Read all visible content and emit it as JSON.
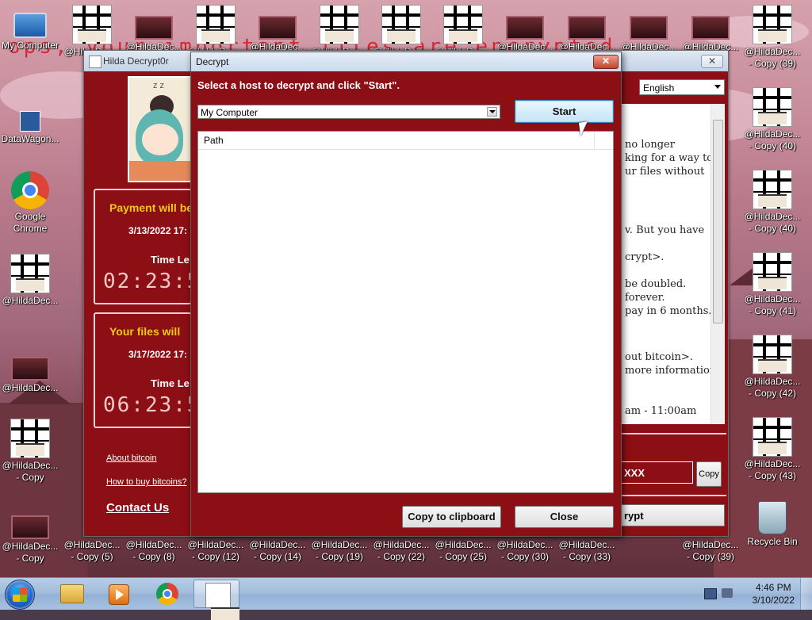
{
  "desktop": {
    "background_text": "ops, your important files are encrypted",
    "icons_top": [
      {
        "label": "My Computer"
      },
      {
        "label": "@HildaDec..."
      },
      {
        "label": "@HildaDec..."
      },
      {
        "label": "@HildaDec..."
      },
      {
        "label": "@HildaDec..."
      },
      {
        "label": "@HildaDec..."
      },
      {
        "label": "@HildaDec..."
      },
      {
        "label": "@HildaDec..."
      },
      {
        "label": "@HildaDec..."
      },
      {
        "label": "@HildaDec..."
      },
      {
        "label": "@HildaDec..."
      },
      {
        "label": "@HildaDec..."
      },
      {
        "label": "@HildaDec..."
      }
    ],
    "icons_left": [
      {
        "label": "DataWagon..."
      },
      {
        "label": "Google Chrome"
      },
      {
        "label": "@HildaDec..."
      },
      {
        "label": "@HildaDec..."
      },
      {
        "label": "@HildaDec...",
        "sub": "- Copy"
      }
    ],
    "icons_right": [
      {
        "label": "@HildaDec...",
        "sub": "- Copy (39)"
      },
      {
        "label": "@HildaDec...",
        "sub": "- Copy (40)"
      },
      {
        "label": "@HildaDec...",
        "sub": "- Copy (40)"
      },
      {
        "label": "@HildaDec...",
        "sub": "- Copy (41)"
      },
      {
        "label": "@HildaDec...",
        "sub": "- Copy (42)"
      },
      {
        "label": "@HildaDec...",
        "sub": "- Copy (43)"
      },
      {
        "label": "Recycle Bin"
      }
    ],
    "icons_bottom": [
      {
        "label": "@HildaDec...",
        "sub": "- Copy"
      },
      {
        "label": "@HildaDec...",
        "sub": "- Copy (5)"
      },
      {
        "label": "@HildaDec...",
        "sub": "- Copy (8)"
      },
      {
        "label": "@HildaDec...",
        "sub": "- Copy (12)"
      },
      {
        "label": "@HildaDec...",
        "sub": "- Copy (14)"
      },
      {
        "label": "@HildaDec...",
        "sub": "- Copy (19)"
      },
      {
        "label": "@HildaDec...",
        "sub": "- Copy (22)"
      },
      {
        "label": "@HildaDec...",
        "sub": "- Copy (25)"
      },
      {
        "label": "@HildaDec...",
        "sub": "- Copy (30)"
      },
      {
        "label": "@HildaDec...",
        "sub": "- Copy (33)"
      },
      {
        "label": "@HildaDec...",
        "sub": "- Copy (39)"
      }
    ]
  },
  "ransom_window": {
    "title": "Hilda Decrypt0r",
    "close_label": "✕",
    "language": "English",
    "payment_panel": {
      "title": "Payment will be",
      "date": "3/13/2022 17:",
      "time_left_label": "Time Le",
      "timer": "02:23:5"
    },
    "files_panel": {
      "title": "Your files will",
      "date": "3/17/2022 17:",
      "time_left_label": "Time Le",
      "timer": "06:23:5"
    },
    "links": {
      "about_bitcoin": "About bitcoin",
      "how_to_buy": "How to buy bitcoins?",
      "contact_us": "Contact Us"
    },
    "message_lines": [
      "no longer",
      "king for a way to",
      "ur files without",
      "v. But you have",
      "crypt>.",
      "be doubled.",
      " forever.",
      "pay in 6 months.",
      "out bitcoin>.",
      "more information,",
      "am - 11:00am"
    ],
    "address": "XXX",
    "copy_label": "Copy",
    "decrypt_label": "rypt"
  },
  "decrypt_dialog": {
    "title": "Decrypt",
    "close_glyph": "✕",
    "instruction": "Select a host to decrypt and click \"Start\".",
    "host_selected": "My Computer",
    "start_label": "Start",
    "list_column": "Path",
    "copy_clipboard_label": "Copy to clipboard",
    "close_label": "Close"
  },
  "taskbar": {
    "clock_time": "4:46 PM",
    "clock_date": "3/10/2022"
  },
  "colors": {
    "ransom_red": "#8b0f14",
    "timer_title_yellow": "#f2c71e"
  }
}
